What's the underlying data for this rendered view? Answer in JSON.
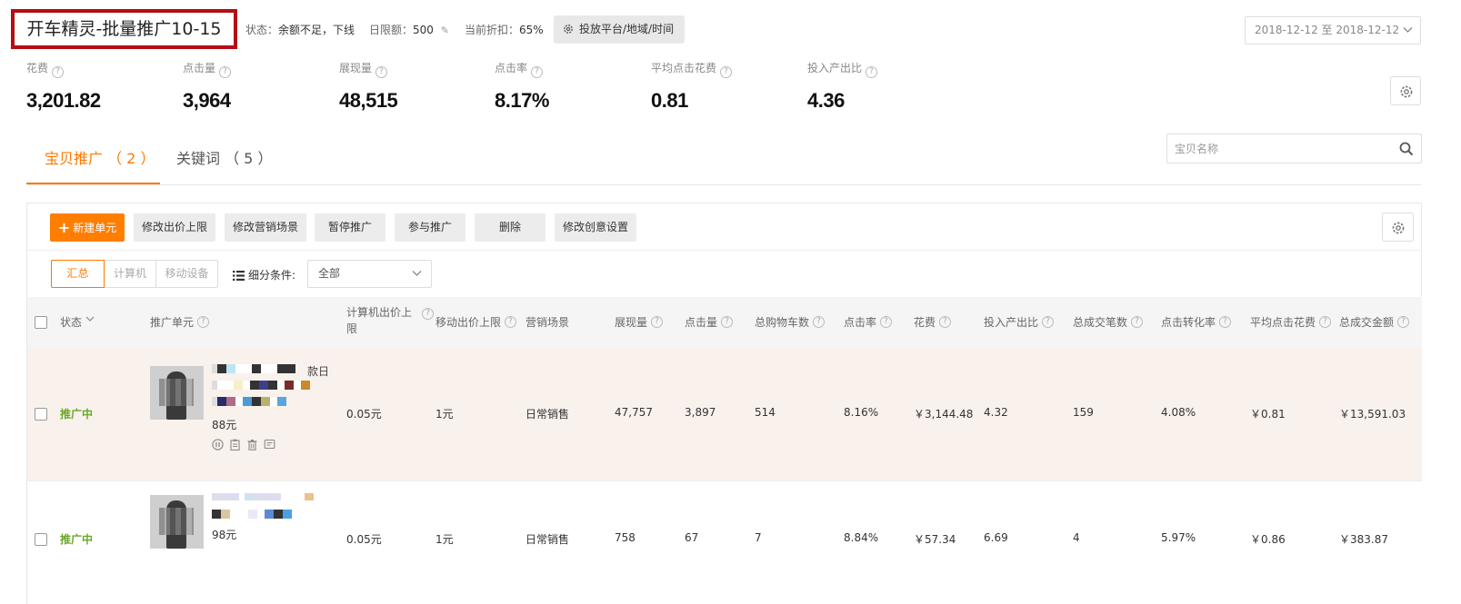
{
  "header": {
    "campaign_title": "开车精灵-批量推广10-15",
    "status_label": "状态：",
    "status_value": "余额不足，下线",
    "daily_limit_label": "日限额：",
    "daily_limit_value": "500",
    "discount_label": "当前折扣：",
    "discount_value": "65%",
    "platform_button": "投放平台/地域/时间",
    "date_range": "2018-12-12 至 2018-12-12"
  },
  "metrics": [
    {
      "label": "花费",
      "value": "3,201.82"
    },
    {
      "label": "点击量",
      "value": "3,964"
    },
    {
      "label": "展现量",
      "value": "48,515"
    },
    {
      "label": "点击率",
      "value": "8.17%"
    },
    {
      "label": "平均点击花费",
      "value": "0.81"
    },
    {
      "label": "投入产出比",
      "value": "4.36"
    }
  ],
  "tabs": {
    "items_tab": "宝贝推广 （ 2 ）",
    "keywords_tab": "关键词 （ 5 ）"
  },
  "search": {
    "placeholder": "宝贝名称"
  },
  "toolbar": {
    "new_unit": "新建单元",
    "edit_bid_limit": "修改出价上限",
    "edit_scene": "修改营销场景",
    "pause": "暂停推广",
    "join": "参与推广",
    "delete": "删除",
    "edit_creative": "修改创意设置"
  },
  "filters": {
    "segments": [
      "汇总",
      "计算机",
      "移动设备"
    ],
    "active_segment": "汇总",
    "condition_label": "细分条件:",
    "condition_value": "全部"
  },
  "table": {
    "headers": {
      "status": "状态",
      "unit": "推广单元",
      "pc_bid": "计算机出价上限",
      "mobile_bid": "移动出价上限",
      "scene": "营销场景",
      "impressions": "展现量",
      "clicks": "点击量",
      "cart": "总购物车数",
      "ctr": "点击率",
      "cost": "花费",
      "roi": "投入产出比",
      "orders": "总成交笔数",
      "cvr": "点击转化率",
      "cpc": "平均点击花费",
      "gmv": "总成交金额"
    },
    "rows": [
      {
        "status": "推广中",
        "title_fragment": "款日",
        "price": "88元",
        "pc_bid": "0.05元",
        "mobile_bid": "1元",
        "scene": "日常销售",
        "impressions": "47,757",
        "clicks": "3,897",
        "cart": "514",
        "ctr": "8.16%",
        "cost": "￥3,144.48",
        "roi": "4.32",
        "orders": "159",
        "cvr": "4.08%",
        "cpc": "￥0.81",
        "gmv": "￥13,591.03"
      },
      {
        "status": "推广中",
        "price": "98元",
        "pc_bid": "0.05元",
        "mobile_bid": "1元",
        "scene": "日常销售",
        "impressions": "758",
        "clicks": "67",
        "cart": "7",
        "ctr": "8.84%",
        "cost": "￥57.34",
        "roi": "6.69",
        "orders": "4",
        "cvr": "5.97%",
        "cpc": "￥0.86",
        "gmv": "￥383.87"
      }
    ]
  },
  "colors": {
    "accent": "#ff7800",
    "title_border": "#b50d14",
    "status_active": "#6aa82a",
    "row_highlight": "#f9f1ec"
  }
}
